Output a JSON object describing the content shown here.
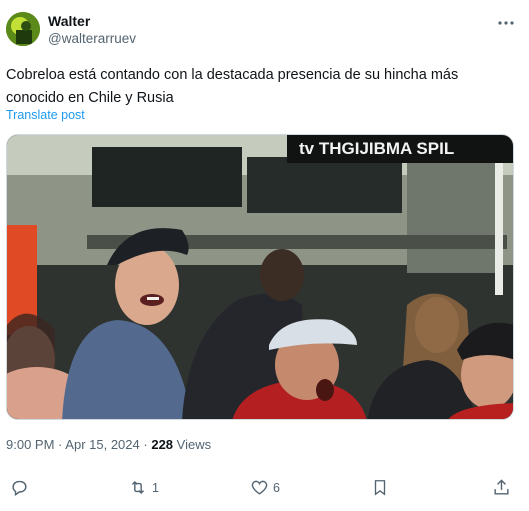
{
  "author": {
    "name": "Walter",
    "handle": "@walterarruev"
  },
  "post": {
    "text": "Cobreloa está contando con la destacada presencia de su hincha más conocido en Chile y Rusia",
    "translate_label": "Translate post",
    "time": "9:00 PM",
    "separator": "·",
    "date": "Apr 15, 2024",
    "views_count": "228",
    "views_label": "Views"
  },
  "media": {
    "banner_text": "tv THGIJIBMA SPIL"
  },
  "actions": {
    "reply_count": "",
    "repost_count": "1",
    "like_count": "6"
  },
  "icons": {
    "more": "more-horizontal-icon",
    "reply": "reply-icon",
    "repost": "repost-icon",
    "like": "heart-icon",
    "bookmark": "bookmark-icon",
    "share": "share-icon"
  },
  "colors": {
    "text": "#0f1419",
    "secondary": "#536471",
    "link": "#1d9bf0",
    "border": "#cfd9de"
  }
}
